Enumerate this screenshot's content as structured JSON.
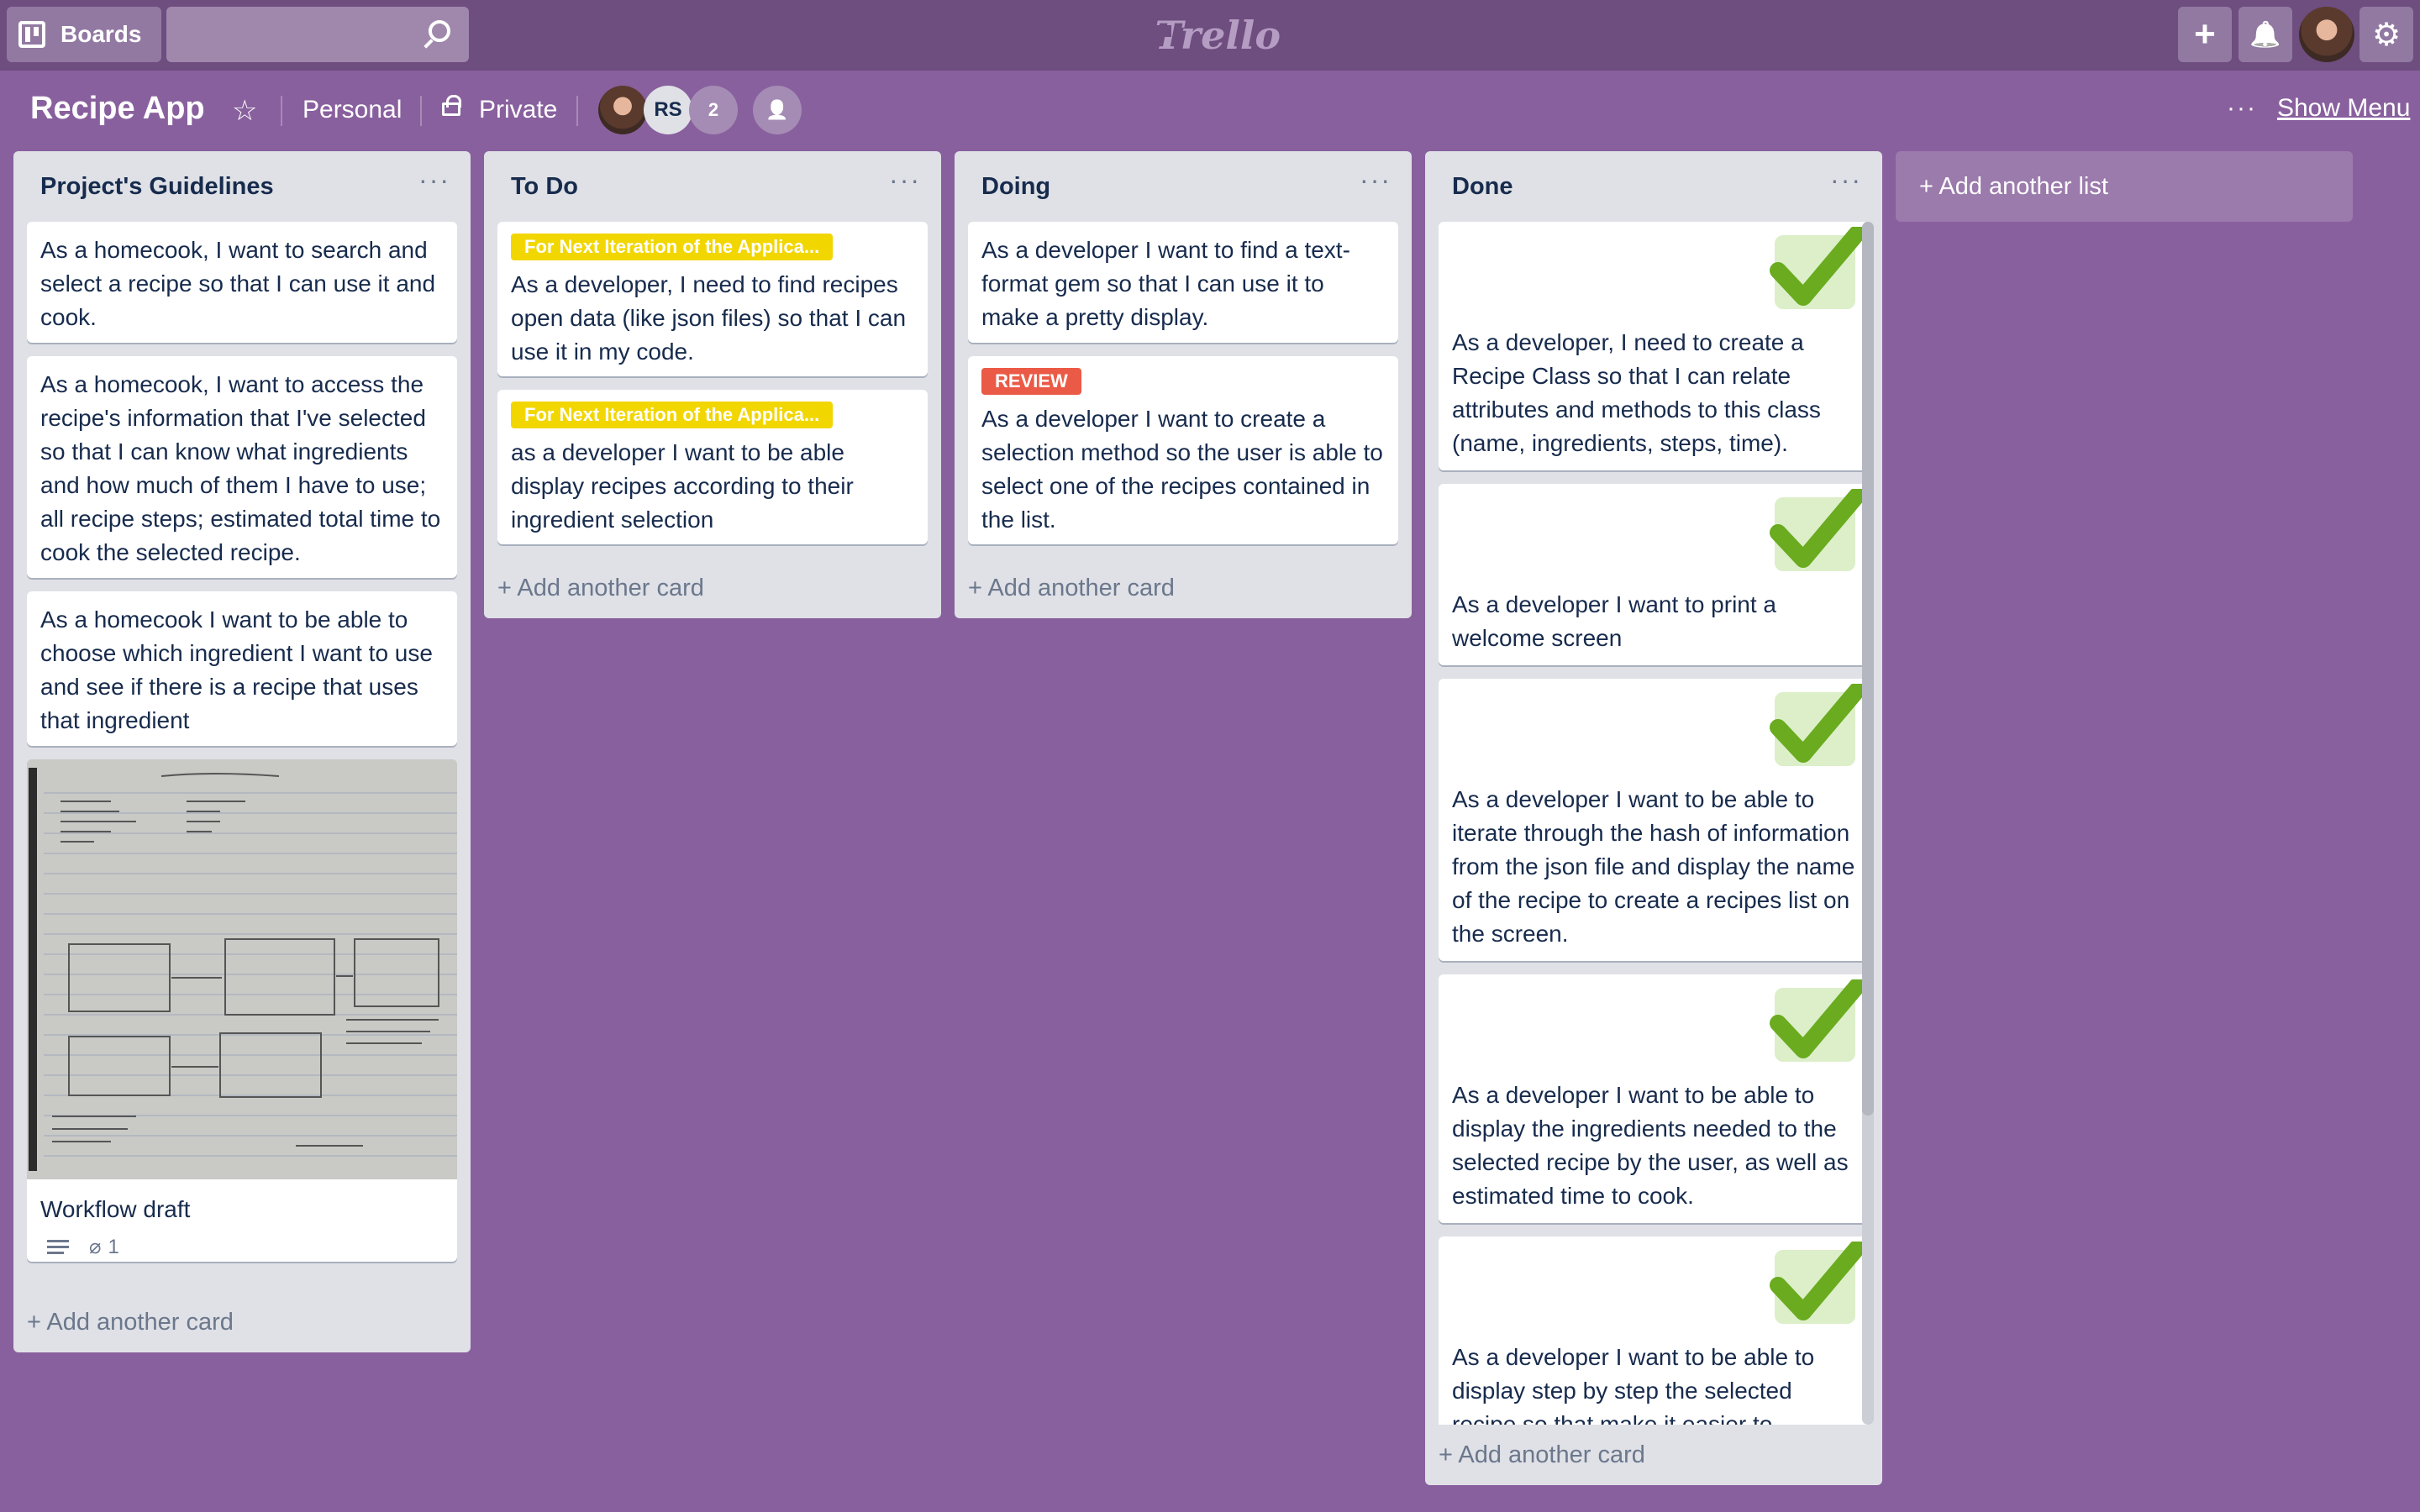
{
  "header": {
    "boards_label": "Boards",
    "search_placeholder": "",
    "logo_text": "Trello",
    "add_glyph": "+",
    "notifications_glyph": "🔔",
    "settings_glyph": "⚙"
  },
  "board": {
    "title": "Recipe App",
    "star_glyph": "☆",
    "team": "Personal",
    "visibility": "Private",
    "members": [
      {
        "initials": ""
      },
      {
        "initials": "RS"
      }
    ],
    "more_members": "2",
    "invite_glyph": "👤",
    "menu_dots": "···",
    "show_menu": "Show Menu"
  },
  "lists": [
    {
      "title": "Project's Guidelines",
      "menu": "···",
      "cards": [
        {
          "text": "As a homecook, I want to search and select a recipe so that I can use it and cook."
        },
        {
          "text": "As a homecook, I want to access the recipe's information that I've selected so that I can know what ingredients and how much of them I have to use; all recipe steps; estimated total time to cook the selected recipe."
        },
        {
          "text": "As a homecook I want to be able to choose which ingredient I want to use and see if there is a recipe that uses that ingredient"
        },
        {
          "text": "Workflow draft",
          "attachments": "1"
        }
      ],
      "add_card": "+ Add another card"
    },
    {
      "title": "To Do",
      "menu": "···",
      "cards": [
        {
          "label": "For Next Iteration of the Applica...",
          "text": "As a developer, I need to find recipes open data (like json files) so that I can use it in my code."
        },
        {
          "label": "For Next Iteration of the Applica...",
          "text": "as a developer I want to be able display recipes according to their ingredient selection"
        }
      ],
      "add_card": "+ Add another card"
    },
    {
      "title": "Doing",
      "menu": "···",
      "cards": [
        {
          "text": "As a developer I want to find a text-format gem so that I can use it to make a pretty display."
        },
        {
          "label": "REVIEW",
          "text": "As a developer I want to create a selection method so the user is able to select one of the recipes contained in the list."
        }
      ],
      "add_card": "+ Add another card"
    },
    {
      "title": "Done",
      "menu": "···",
      "cards": [
        {
          "text": "As a developer, I need to create a Recipe Class so that I can relate attributes and methods to this class (name, ingredients, steps, time)."
        },
        {
          "text": "As a developer I want to print a welcome screen"
        },
        {
          "text": "As a developer I want to be able to iterate through the hash of information from the json file and display the name of the recipe to create a recipes list on the screen."
        },
        {
          "text": "As a developer I want to be able to display the ingredients needed to the selected recipe by the user, as well as estimated time to cook."
        },
        {
          "text": "As a developer I want to be able to display step by step the selected recipe so that make it easier to"
        }
      ],
      "add_card": "+ Add another card"
    }
  ],
  "add_list": "+ Add another list",
  "colors": {
    "background": "#89609e",
    "topbar": "#6e4d7f",
    "label_yellow": "#f2d600",
    "label_red": "#eb5a46",
    "check_green": "#6aab1f"
  }
}
